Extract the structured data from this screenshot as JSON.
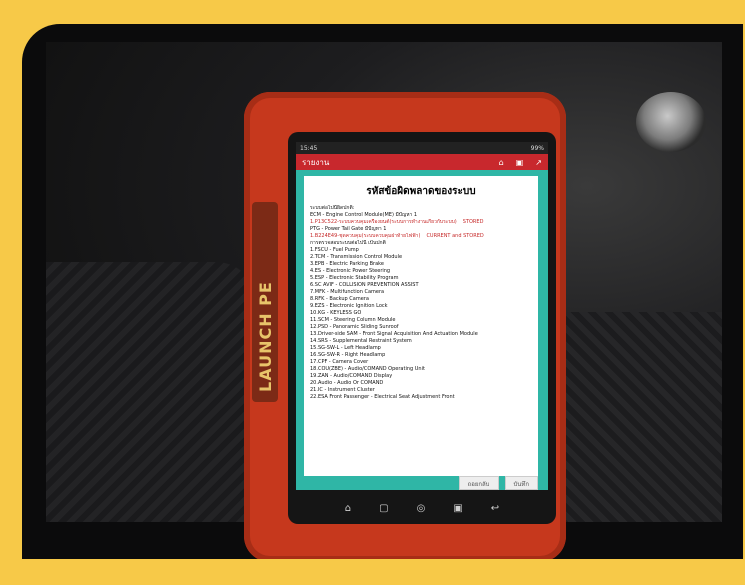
{
  "device": {
    "brand": "LAUNCH PE",
    "statusbar": {
      "time": "15:45",
      "battery": "99%"
    },
    "appbar": {
      "title": "รายงาน",
      "icons": [
        "home-icon",
        "printer-icon",
        "share-icon"
      ]
    },
    "document": {
      "title": "รหัสข้อผิดพลาดของระบบ",
      "lines": [
        {
          "text": "ระบบต่อไปนี้ผิดปกติ:",
          "red": false
        },
        {
          "text": "ECM - Engine Control Module(ME) มีปัญหา 1",
          "red": false
        },
        {
          "text": "1.P13C522-ระบบควบคุมเครื่องยนต์(ระบบการทำงานเกี่ยวกับระบบ)",
          "red": true,
          "status": "STORED"
        },
        {
          "text": "PTG - Power Tail Gate มีปัญหา 1",
          "red": false
        },
        {
          "text": "1.B224E49-ชุดควบคุม(ระบบควบคุมฝาท้ายไฟฟ้า)",
          "red": true,
          "status": "CURRENT and STORED"
        },
        {
          "text": "การตรวจสอบระบบต่อไปนี้ เป็นปกติ",
          "red": false
        },
        {
          "text": "1.FSCU - Fuel Pump",
          "red": false
        },
        {
          "text": "2.TCM - Transmission Control Module",
          "red": false
        },
        {
          "text": "3.EPB - Electric Parking Brake",
          "red": false
        },
        {
          "text": "4.ES - Electronic Power Steering",
          "red": false
        },
        {
          "text": "5.ESP - Electronic Stability Program",
          "red": false
        },
        {
          "text": "6.SC AVIF - COLLISION PREVENTION ASSIST",
          "red": false
        },
        {
          "text": "7.MFK - Multifunction Camera",
          "red": false
        },
        {
          "text": "8.RFK - Backup Camera",
          "red": false
        },
        {
          "text": "9.EZS - Electronic Ignition Lock",
          "red": false
        },
        {
          "text": "10.KG - KEYLESS GO",
          "red": false
        },
        {
          "text": "11.SCM - Steering Column Module",
          "red": false
        },
        {
          "text": "12.PSD - Panoramic Sliding Sunroof",
          "red": false
        },
        {
          "text": "13.Driver-side SAM - Front Signal Acquisition And Actuation Module",
          "red": false
        },
        {
          "text": "14.SRS - Supplemental Restraint System",
          "red": false
        },
        {
          "text": "15.SG-SW-L - Left Headlamp",
          "red": false
        },
        {
          "text": "16.SG-SW-R - Right Headlamp",
          "red": false
        },
        {
          "text": "17.CPF - Camera Cover",
          "red": false
        },
        {
          "text": "18.COU(ZBE) - Audio/COMAND Operating Unit",
          "red": false
        },
        {
          "text": "19.ZAN - Audio/COMAND Display",
          "red": false
        },
        {
          "text": "20.Audio - Audio Or COMAND",
          "red": false
        },
        {
          "text": "21.IC - Instrument Cluster",
          "red": false
        },
        {
          "text": "22.ESA Front Passenger - Electrical Seat Adjustment Front",
          "red": false
        }
      ]
    },
    "footer_buttons": [
      "ถอยกลับ",
      "บันทึก"
    ],
    "nav_icons": [
      "home-icon",
      "recent-icon",
      "app-icon",
      "gallery-icon",
      "back-icon"
    ]
  }
}
